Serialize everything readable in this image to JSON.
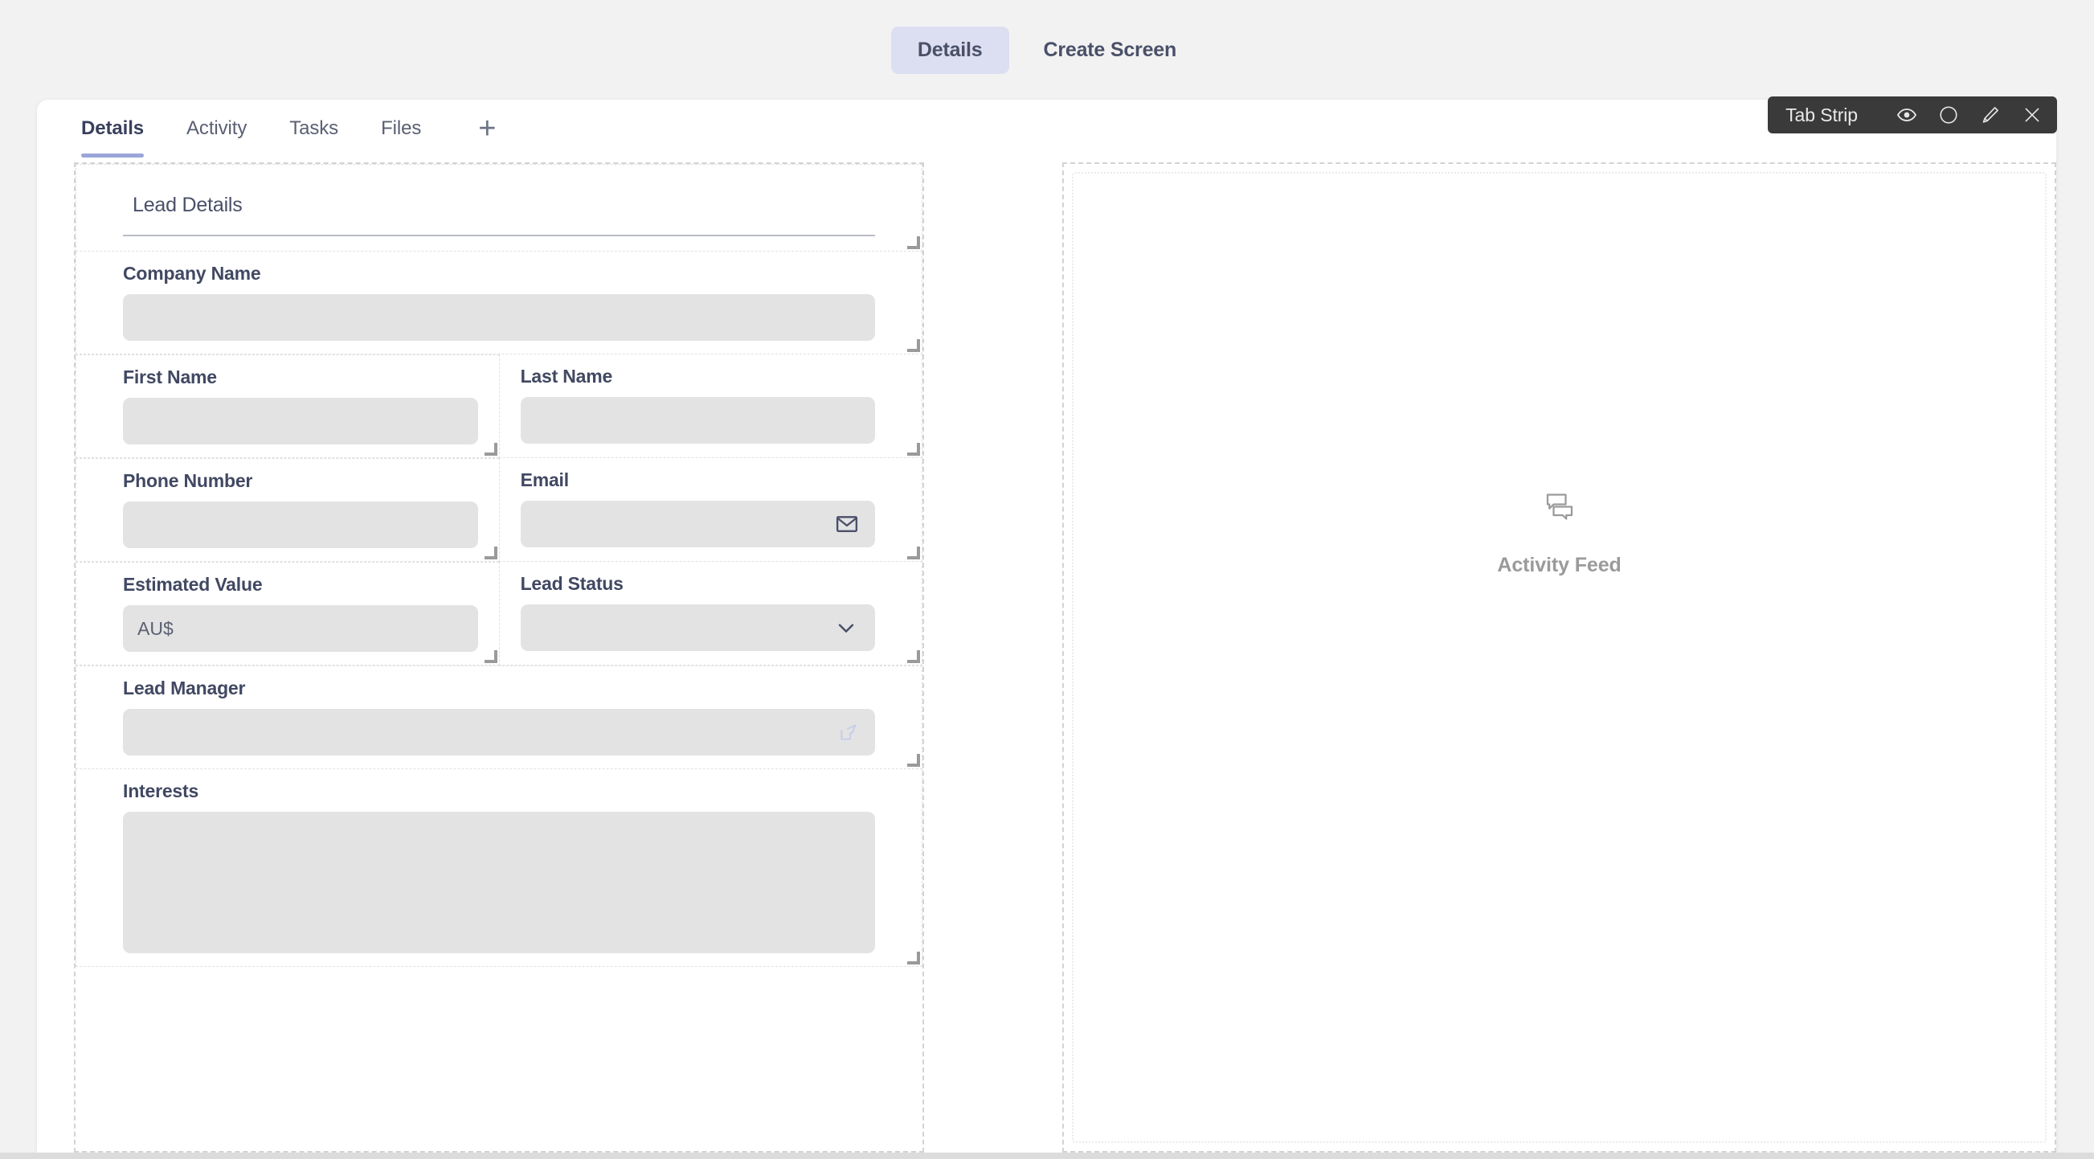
{
  "mode_switch": {
    "options": [
      {
        "label": "Details",
        "active": true
      },
      {
        "label": "Create Screen",
        "active": false
      }
    ]
  },
  "tab_strip": {
    "tabs": [
      {
        "label": "Details",
        "active": true
      },
      {
        "label": "Activity",
        "active": false
      },
      {
        "label": "Tasks",
        "active": false
      },
      {
        "label": "Files",
        "active": false
      }
    ],
    "add_tab_glyph": "+"
  },
  "toolbar": {
    "title": "Tab Strip",
    "actions": [
      {
        "name": "preview",
        "icon": "eye-icon"
      },
      {
        "name": "select",
        "icon": "circle-icon"
      },
      {
        "name": "edit",
        "icon": "pencil-icon"
      },
      {
        "name": "close",
        "icon": "close-icon"
      }
    ]
  },
  "form": {
    "section_title": "Lead Details",
    "fields": [
      {
        "label": "Company Name",
        "value": "",
        "placeholder": "",
        "adornment": "none",
        "type": "text"
      },
      {
        "label": "First Name",
        "value": "",
        "placeholder": "",
        "adornment": "none",
        "type": "text"
      },
      {
        "label": "Last Name",
        "value": "",
        "placeholder": "",
        "adornment": "none",
        "type": "text"
      },
      {
        "label": "Phone Number",
        "value": "",
        "placeholder": "",
        "adornment": "none",
        "type": "text"
      },
      {
        "label": "Email",
        "value": "",
        "placeholder": "",
        "adornment": "mail-icon",
        "type": "email"
      },
      {
        "label": "Estimated Value",
        "value": "AU$",
        "placeholder": "",
        "adornment": "none",
        "type": "currency"
      },
      {
        "label": "Lead Status",
        "value": "",
        "placeholder": "",
        "adornment": "chevron-down-icon",
        "type": "select"
      },
      {
        "label": "Lead Manager",
        "value": "",
        "placeholder": "",
        "adornment": "external-link-icon",
        "type": "lookup"
      },
      {
        "label": "Interests",
        "value": "",
        "placeholder": "",
        "adornment": "none",
        "type": "textarea"
      }
    ]
  },
  "activity_panel": {
    "placeholder_label": "Activity Feed",
    "placeholder_icon": "chat-bubbles-icon"
  },
  "colors": {
    "page_background": "#f2f2f3",
    "card_background": "#ffffff",
    "accent_active_pill": "#dcdff1",
    "accent_tab_underline": "#9aa5d8",
    "text_primary": "#39405c",
    "text_secondary": "#5a6072",
    "input_fill": "#e3e3e4",
    "toolbar_background": "#3a3a3a",
    "placeholder_text": "#9a9a9c"
  }
}
